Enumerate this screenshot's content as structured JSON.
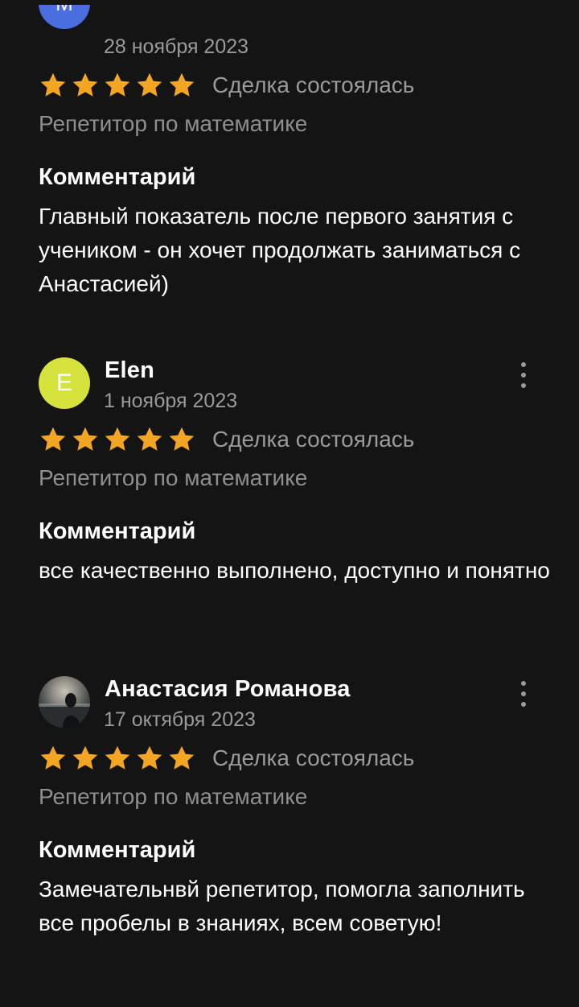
{
  "reviews": [
    {
      "avatar_letter": "М",
      "avatar_color": "#4a6ee0",
      "author": "",
      "date": "28 ноября 2023",
      "rating": 5,
      "deal_status": "Сделка состоялась",
      "service": "Репетитор по математике",
      "comment_heading": "Комментарий",
      "comment": "Главный показатель после первого занятия с учеником - он хочет продолжать заниматься с Анастасией)"
    },
    {
      "avatar_letter": "E",
      "avatar_color": "#d6e33c",
      "author": "Elen",
      "date": "1 ноября 2023",
      "rating": 5,
      "deal_status": "Сделка состоялась",
      "service": "Репетитор по математике",
      "comment_heading": "Комментарий",
      "comment": "все качественно выполнено, доступно и понятно"
    },
    {
      "avatar_letter": "",
      "avatar_color": "#3a3d42",
      "author": "Анастасия Романова",
      "date": "17 октября 2023",
      "rating": 5,
      "deal_status": "Сделка состоялась",
      "service": "Репетитор по математике",
      "comment_heading": "Комментарий",
      "comment": "Замечательнвй репетитор, помогла заполнить все пробелы в знаниях, всем советую!"
    }
  ],
  "icons": {
    "star": "star-icon",
    "menu": "more-vertical-icon"
  },
  "colors": {
    "background": "#141414",
    "star": "#f5a524",
    "muted_text": "#9a9a9a"
  }
}
